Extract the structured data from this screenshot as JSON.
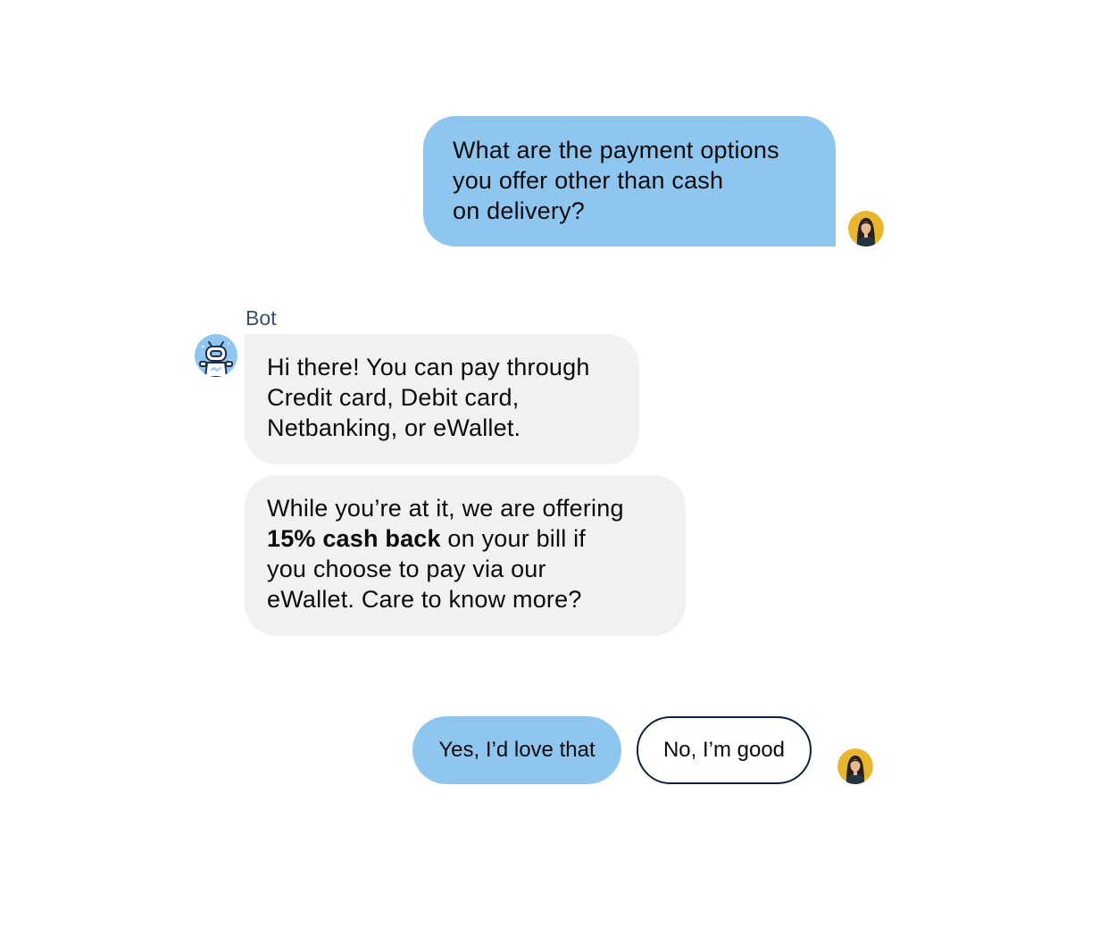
{
  "conversation": {
    "user_message": {
      "lines": [
        "What are the payment options",
        "you offer other than cash",
        "on delivery?"
      ]
    },
    "bot": {
      "sender_label": "Bot",
      "message_1": {
        "lines": [
          "Hi there! You can pay through",
          "Credit card, Debit card,",
          "Netbanking, or eWallet."
        ]
      },
      "message_2": {
        "line_1": "While you’re at it, we are offering",
        "line_2_bold": "15% cash back",
        "line_2_rest": " on your bill if",
        "line_3": "you choose to pay via our",
        "line_4": "eWallet. Care to know more?"
      }
    },
    "quick_replies": [
      {
        "label": "Yes, I’d love that"
      },
      {
        "label": "No, I’m good"
      }
    ]
  },
  "icons": {
    "user_avatar": "user-avatar-icon",
    "bot_avatar": "robot-icon"
  },
  "colors": {
    "user_bubble": "#8fc6ef",
    "bot_bubble": "#f1f1f1",
    "outline_button_border": "#0f2240",
    "sender_label": "#3c4e69",
    "avatar_background": "#e8b52f"
  }
}
